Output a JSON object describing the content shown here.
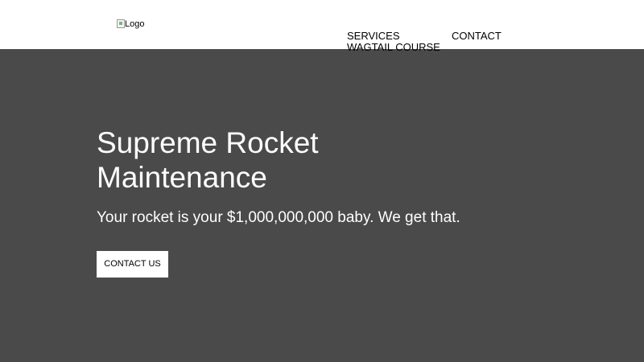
{
  "header": {
    "logo_alt": "Logo",
    "nav": {
      "services": "SERVICES",
      "contact": "CONTACT",
      "wagtail_course": "WAGTAIL COURSE"
    }
  },
  "hero": {
    "title": "Supreme Rocket Maintenance",
    "subtitle": "Your rocket is your $1,000,000,000 baby. We get that.",
    "cta_label": "CONTACT US"
  },
  "colors": {
    "hero_background": "#4a4a4a",
    "header_background": "#ffffff",
    "button_background": "#ffffff"
  },
  "icons": {
    "logo": "broken-image-icon"
  }
}
